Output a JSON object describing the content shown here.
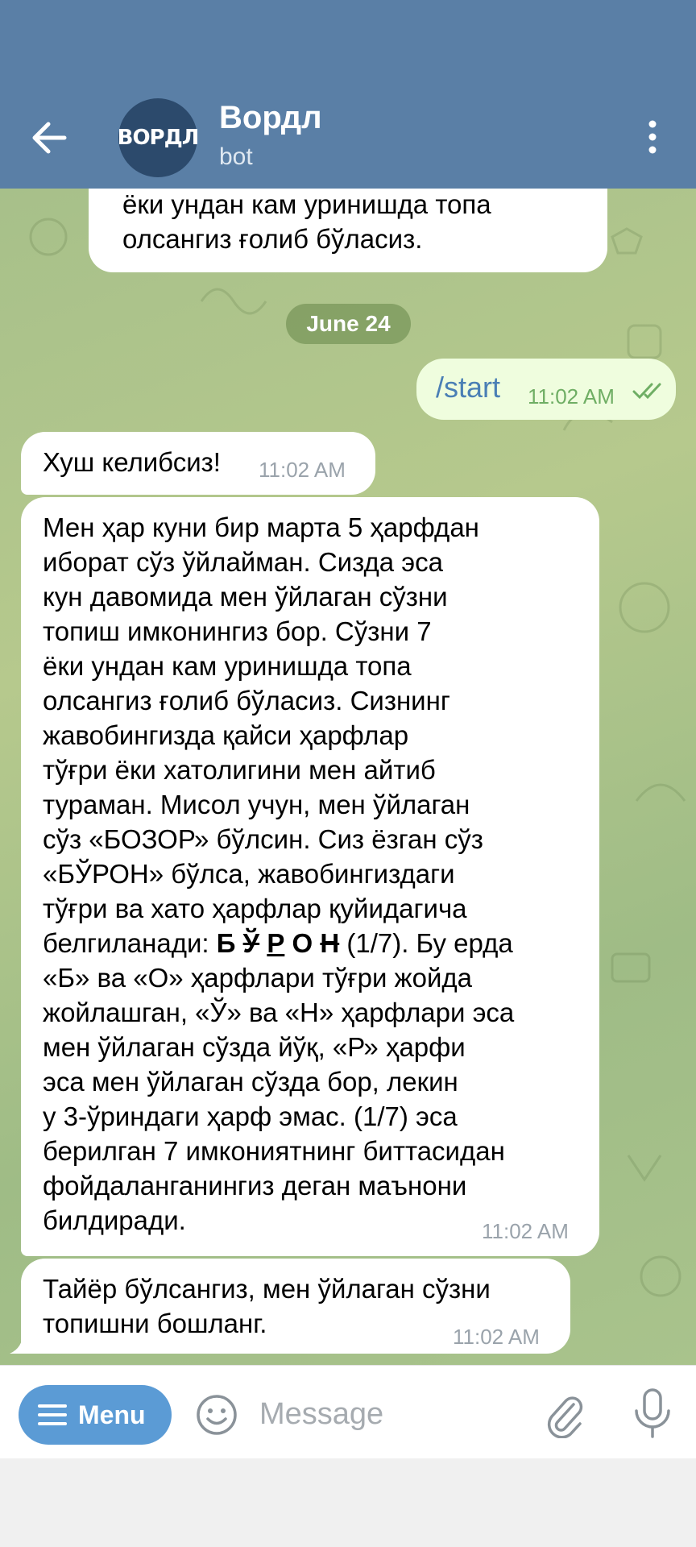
{
  "header": {
    "avatar_text": "ВОРДЛ",
    "title": "Вордл",
    "subtitle": "bot",
    "colors": {
      "bar": "#5a7fa6",
      "avatar": "#2c4a6c"
    }
  },
  "chat": {
    "top_partial": {
      "line1": "ёки ундан кам уринишда топа",
      "line2": "олсангиз ғолиб бўласиз."
    },
    "date_separator": "June 24",
    "outgoing": {
      "text": "/start",
      "time": "11:02 AM",
      "status": "read-double-check-icon"
    },
    "welcome": {
      "text": "Хуш келибсиз!",
      "time": "11:02 AM"
    },
    "rules": {
      "part1": "Мен ҳар куни бир марта 5 ҳарфдан\nиборат сўз ўйлайман. Сизда эса\nкун давомида мен ўйлаган сўзни\nтопиш имконингиз бор. Сўзни 7\nёки ундан кам уринишда топа\nолсангиз ғолиб бўласиз. Сизнинг\nжавобингизда қайси ҳарфлар\nтўғри ёки хатолигини мен айтиб\nтураман. Мисол учун, мен ўйлаган\nсўз «БОЗОР» бўлсин. Сиз ёзган сўз\n«БЎРОН» бўлса, жавобингиздаги\nтўғри ва хато ҳарфлар қуйидагича\nбелгиланади: ",
      "example": {
        "l1": "Б",
        "l2": "Ў",
        "l3": "Р",
        "l4": "О",
        "l5": "Н"
      },
      "part2": " (1/7). Бу ерда\n«Б» ва «О» ҳарфлари тўғри жойда\nжойлашган, «Ў» ва «Н» ҳарфлари эса\nмен ўйлаган сўзда йўқ, «Р» ҳарфи\nэса мен ўйлаган сўзда бор, лекин\nу 3-ўриндаги ҳарф эмас. (1/7) эса\nберилган 7 имкониятнинг биттасидан\nфойдаланганингиз деган маънони\nбилдиради.",
      "time": "11:02 AM"
    },
    "ready": {
      "text": "Тайёр бўлсангиз, мен ўйлаган сўзни\nтопишни бошланг.",
      "time": "11:02 AM"
    },
    "colors": {
      "outgoing_bubble": "#effdde",
      "incoming_bubble": "#ffffff",
      "link": "#4a7fb5",
      "check": "#6fae64"
    }
  },
  "input_bar": {
    "menu_label": "Menu",
    "message_placeholder": "Message",
    "colors": {
      "menu_button": "#5b9bd5"
    }
  }
}
